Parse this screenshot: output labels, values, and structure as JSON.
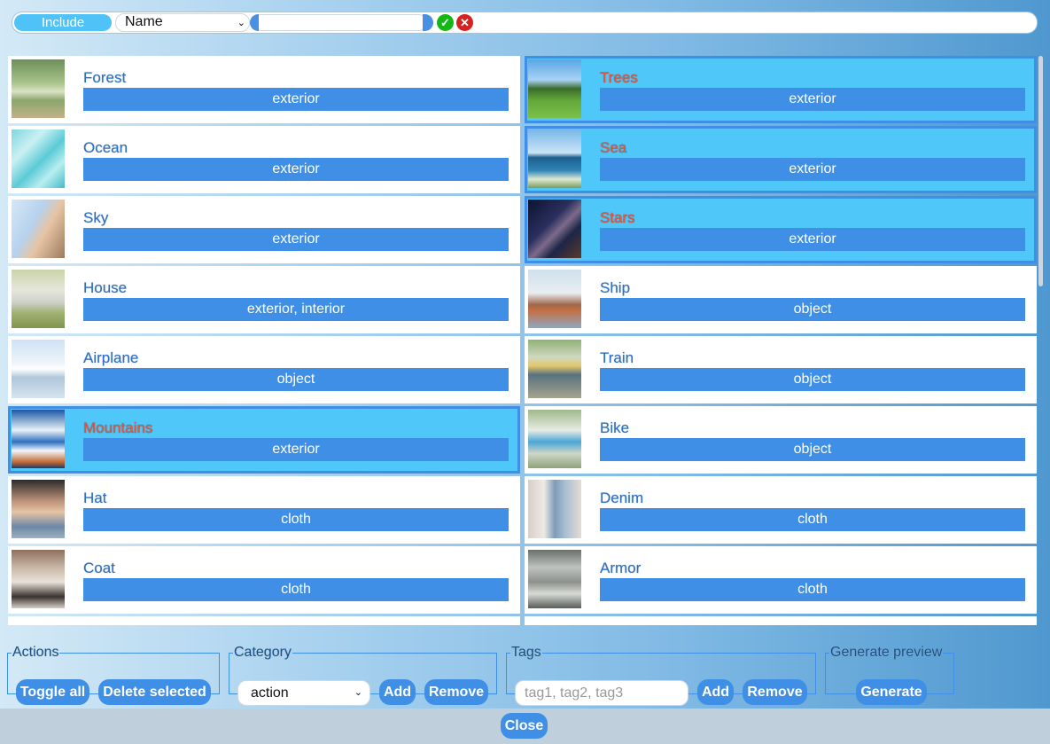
{
  "filter": {
    "mode_label": "Include",
    "field_selected": "Name",
    "value": ""
  },
  "items": [
    {
      "name": "Forest",
      "tags": "exterior",
      "selected": false,
      "thumb": "forest-path"
    },
    {
      "name": "Trees",
      "tags": "exterior",
      "selected": true,
      "thumb": "trees-field"
    },
    {
      "name": "Ocean",
      "tags": "exterior",
      "selected": false,
      "thumb": "ocean-waves"
    },
    {
      "name": "Sea",
      "tags": "exterior",
      "selected": true,
      "thumb": "sea-coast"
    },
    {
      "name": "Sky",
      "tags": "exterior",
      "selected": false,
      "thumb": "sky-face"
    },
    {
      "name": "Stars",
      "tags": "exterior",
      "selected": true,
      "thumb": "milky-way"
    },
    {
      "name": "House",
      "tags": "exterior, interior",
      "selected": false,
      "thumb": "house"
    },
    {
      "name": "Ship",
      "tags": "object",
      "selected": false,
      "thumb": "sailing-ship"
    },
    {
      "name": "Airplane",
      "tags": "object",
      "selected": false,
      "thumb": "airplane"
    },
    {
      "name": "Train",
      "tags": "object",
      "selected": false,
      "thumb": "train"
    },
    {
      "name": "Mountains",
      "tags": "exterior",
      "selected": true,
      "thumb": "mountains"
    },
    {
      "name": "Bike",
      "tags": "object",
      "selected": false,
      "thumb": "bicycle"
    },
    {
      "name": "Hat",
      "tags": "cloth",
      "selected": false,
      "thumb": "woman-hat"
    },
    {
      "name": "Denim",
      "tags": "cloth",
      "selected": false,
      "thumb": "jeans"
    },
    {
      "name": "Coat",
      "tags": "cloth",
      "selected": false,
      "thumb": "coat"
    },
    {
      "name": "Armor",
      "tags": "cloth",
      "selected": false,
      "thumb": "armor"
    }
  ],
  "actions": {
    "legend": "Actions",
    "toggle_all": "Toggle all",
    "delete_selected": "Delete selected"
  },
  "category": {
    "legend": "Category",
    "selected": "action",
    "add": "Add",
    "remove": "Remove"
  },
  "tags": {
    "legend": "Tags",
    "placeholder": "tag1, tag2, tag3",
    "add": "Add",
    "remove": "Remove"
  },
  "preview": {
    "legend": "Generate preview",
    "generate": "Generate"
  },
  "close_label": "Close",
  "colors": {
    "accent": "#3f8fe6",
    "selected_bg": "#4fc8f9",
    "selected_name": "#e9573f",
    "name": "#2e6fc6"
  }
}
